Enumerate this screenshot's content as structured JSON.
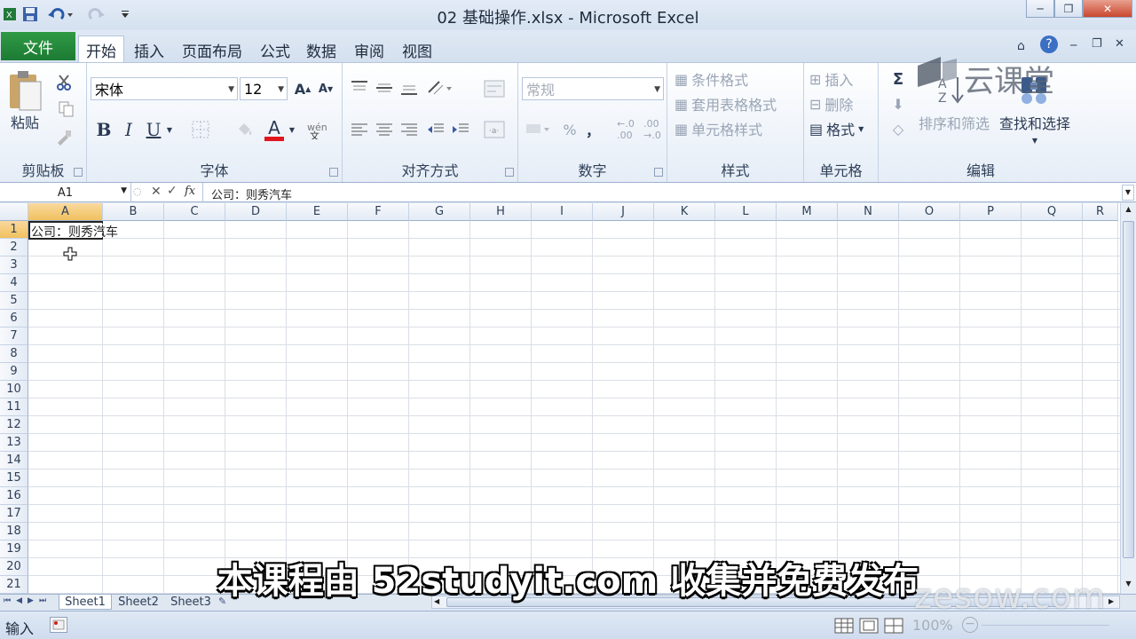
{
  "window": {
    "title": "02 基础操作.xlsx - Microsoft Excel"
  },
  "ribbon_tabs": {
    "file": "文件",
    "home": "开始",
    "insert": "插入",
    "page_layout": "页面布局",
    "formulas": "公式",
    "data": "数据",
    "review": "审阅",
    "view": "视图"
  },
  "clipboard": {
    "paste": "粘贴",
    "label": "剪贴板"
  },
  "font": {
    "name": "宋体",
    "size": "12",
    "bold": "B",
    "italic": "I",
    "underline": "U",
    "color_a": "A",
    "grow": "A",
    "shrink": "A",
    "label": "字体"
  },
  "alignment": {
    "label": "对齐方式"
  },
  "number": {
    "format": "常规",
    "percent": "%",
    "comma": "，",
    "label": "数字"
  },
  "styles": {
    "conditional": "条件格式",
    "table": "套用表格格式",
    "cell": "单元格样式",
    "label": "样式"
  },
  "cells": {
    "insert": "插入",
    "delete": "删除",
    "format": "格式",
    "label": "单元格"
  },
  "editing": {
    "sort_filter": "排序和筛选",
    "find_select": "查找和选择",
    "sigma": "Σ",
    "label": "编辑"
  },
  "formula_bar": {
    "name_box": "A1",
    "fx": "fx",
    "content": "公司：则秀汽车"
  },
  "grid": {
    "columns": [
      "A",
      "B",
      "C",
      "D",
      "E",
      "F",
      "G",
      "H",
      "I",
      "J",
      "K",
      "L",
      "M",
      "N",
      "O",
      "P",
      "Q",
      "R"
    ],
    "rows": [
      "1",
      "2",
      "3",
      "4",
      "5",
      "6",
      "7",
      "8",
      "9",
      "10",
      "11",
      "12",
      "13",
      "14",
      "15",
      "16",
      "17",
      "18",
      "19",
      "20",
      "21"
    ],
    "a1": "公司：则秀汽车"
  },
  "sheets": [
    "Sheet1",
    "Sheet2",
    "Sheet3"
  ],
  "status": {
    "mode": "输入",
    "zoom": "100%"
  },
  "overlay": {
    "subtitle": "本课程由 52studyit.com 收集并免费发布",
    "watermark": "zesow.com",
    "logo": "云课堂"
  },
  "colors": {
    "file_tab": "#1d7b33",
    "selected_header": "#f1c15f",
    "font_color_bar": "#e0161e"
  }
}
